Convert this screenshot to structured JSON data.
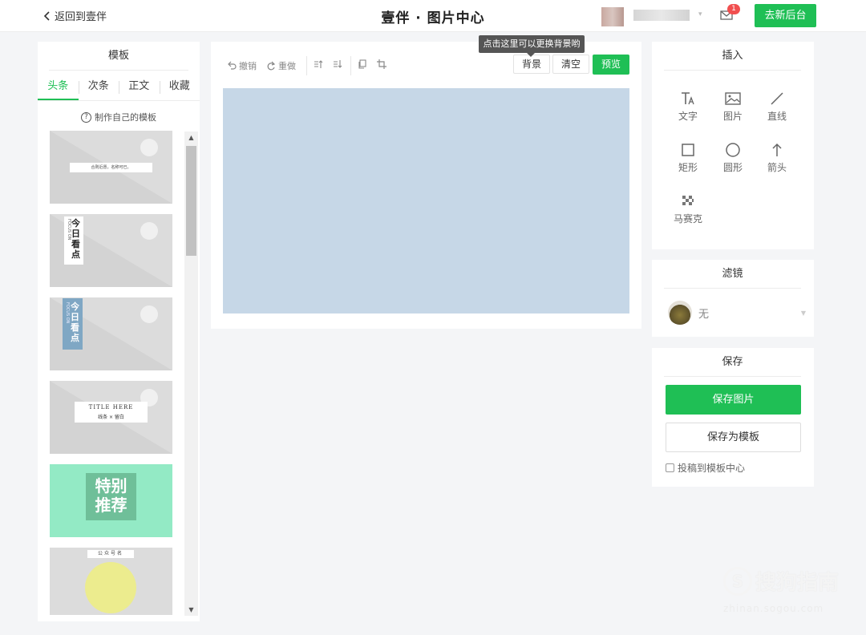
{
  "header": {
    "back_label": "返回到壹伴",
    "app_title": "壹伴 · 图片中心",
    "notification_count": "1",
    "go_backend_label": "去新后台"
  },
  "templates": {
    "title": "模板",
    "tabs": [
      "头条",
      "次条",
      "正文",
      "收藏"
    ],
    "active_tab": "头条",
    "make_own_label": "制作自己的模板",
    "items": [
      {
        "text": "合则近愿，名称可已。"
      },
      {
        "text": "今日看点",
        "sub": "FOCUS ON"
      },
      {
        "text": "今日看点",
        "sub": "FOCUS ON"
      },
      {
        "text": "TITLE HERE",
        "sub": "线条 × 留白"
      },
      {
        "text": "特别推荐"
      },
      {
        "text": "公众号名"
      }
    ]
  },
  "editor": {
    "undo_label": "撤销",
    "redo_label": "重做",
    "background_label": "背景",
    "clear_label": "清空",
    "preview_label": "预览",
    "tooltip": "点击这里可以更换背景哟",
    "canvas_color": "#c6d7e7"
  },
  "insert": {
    "title": "插入",
    "items": [
      {
        "label": "文字",
        "icon": "text-icon"
      },
      {
        "label": "图片",
        "icon": "image-icon"
      },
      {
        "label": "直线",
        "icon": "line-icon"
      },
      {
        "label": "矩形",
        "icon": "rectangle-icon"
      },
      {
        "label": "圆形",
        "icon": "circle-icon"
      },
      {
        "label": "箭头",
        "icon": "arrow-icon"
      },
      {
        "label": "马赛克",
        "icon": "mosaic-icon"
      }
    ]
  },
  "filter": {
    "title": "滤镜",
    "selected": "无"
  },
  "save": {
    "title": "保存",
    "save_image_label": "保存图片",
    "save_template_label": "保存为模板",
    "submit_label": "投稿到模板中心"
  },
  "watermark": {
    "text": "搜狗指南",
    "url": "zhinan.sogou.com"
  },
  "colors": {
    "accent": "#1fbf55",
    "badge": "#f14f4f"
  }
}
